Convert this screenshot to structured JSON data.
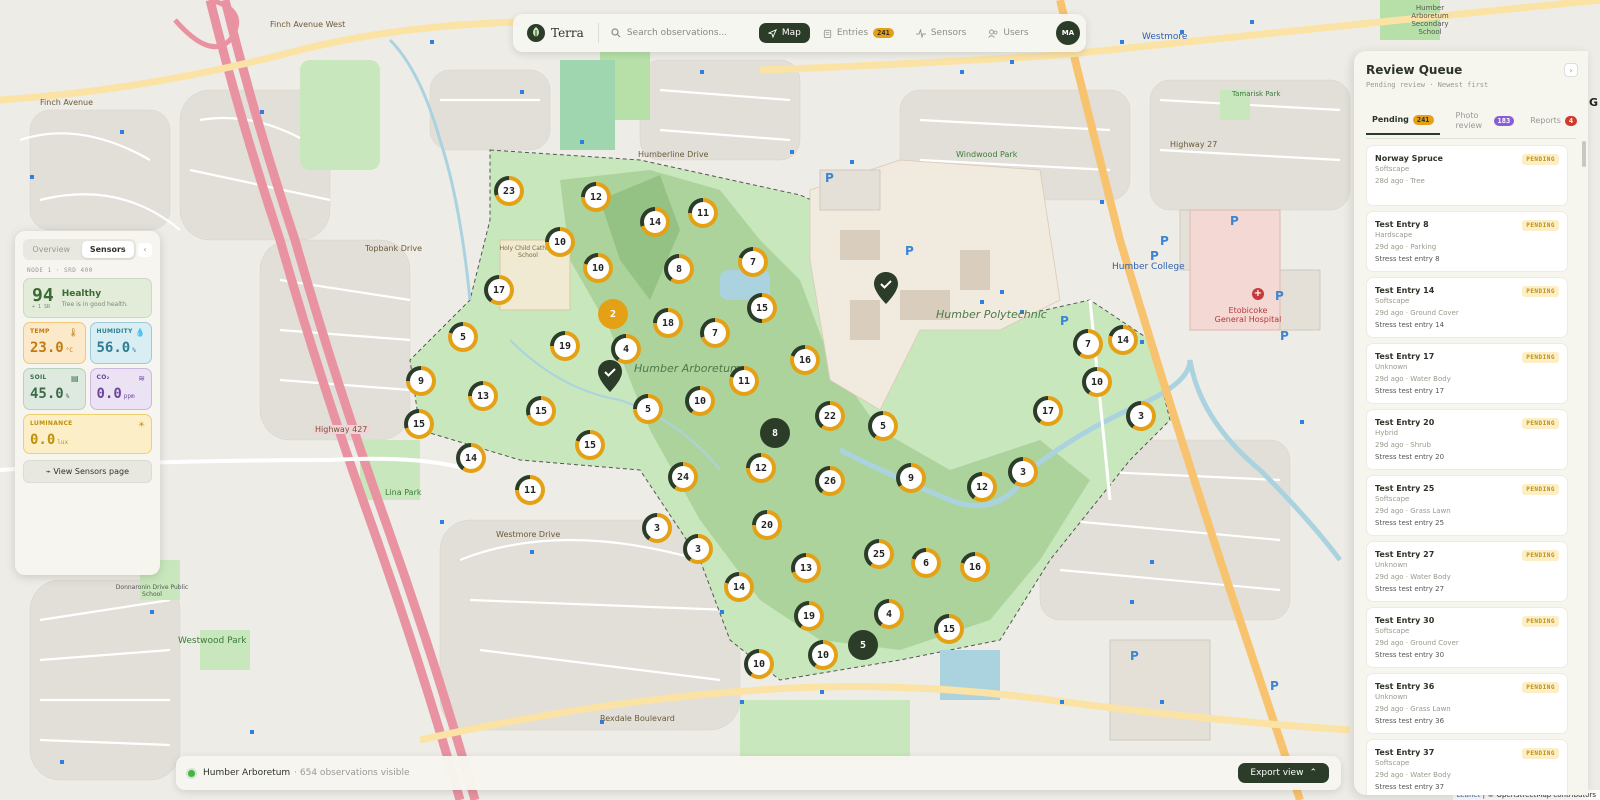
{
  "app": {
    "name": "Terra"
  },
  "nav": {
    "search_placeholder": "Search observations...",
    "tabs": [
      {
        "label": "Map",
        "icon": "navigation-arrow-icon",
        "active": true
      },
      {
        "label": "Entries",
        "icon": "clipboard-icon",
        "badge": "241"
      },
      {
        "label": "Sensors",
        "icon": "activity-pulse-icon"
      },
      {
        "label": "Users",
        "icon": "users-icon"
      }
    ],
    "user_initials": "MA"
  },
  "left_panel": {
    "tabs": [
      "Overview",
      "Sensors"
    ],
    "active_tab": "Sensors",
    "node_id": "NODE 1",
    "node_code": "SRD 400",
    "health": {
      "score": "94",
      "score_sub": "+ 1 SR",
      "title": "Healthy",
      "subtitle": "Tree is in good health."
    },
    "metrics": {
      "temp": {
        "label": "TEMP",
        "value": "23.0",
        "unit": "°C",
        "icon": "thermometer-icon"
      },
      "humidity": {
        "label": "HUMIDITY",
        "value": "56.0",
        "unit": "%",
        "icon": "droplet-icon"
      },
      "soil": {
        "label": "SOIL",
        "value": "45.0",
        "unit": "%",
        "icon": "soil-icon"
      },
      "co2": {
        "label": "CO₂",
        "value": "0.0",
        "unit": "ppm",
        "icon": "co2-icon"
      },
      "luminance": {
        "label": "LUMINANCE",
        "value": "0.0",
        "unit": "lux",
        "icon": "sun-icon"
      }
    },
    "button_label": "View Sensors page"
  },
  "queue": {
    "title": "Review Queue",
    "subtitle": "Pending review · Newest first",
    "tabs": [
      {
        "label": "Pending",
        "badge": "241",
        "active": true
      },
      {
        "label": "Photo review",
        "badge": "183"
      },
      {
        "label": "Reports",
        "badge": "4"
      }
    ],
    "items": [
      {
        "title": "Norway Spruce",
        "category": "Softscape",
        "meta": "28d ago · Tree",
        "note": "",
        "status": "PENDING"
      },
      {
        "title": "Test Entry 8",
        "category": "Hardscape",
        "meta": "29d ago · Parking",
        "note": "Stress test entry 8",
        "status": "PENDING"
      },
      {
        "title": "Test Entry 14",
        "category": "Softscape",
        "meta": "29d ago · Ground Cover",
        "note": "Stress test entry 14",
        "status": "PENDING"
      },
      {
        "title": "Test Entry 17",
        "category": "Unknown",
        "meta": "29d ago · Water Body",
        "note": "Stress test entry 17",
        "status": "PENDING"
      },
      {
        "title": "Test Entry 20",
        "category": "Hybrid",
        "meta": "29d ago · Shrub",
        "note": "Stress test entry 20",
        "status": "PENDING"
      },
      {
        "title": "Test Entry 25",
        "category": "Softscape",
        "meta": "29d ago · Grass Lawn",
        "note": "Stress test entry 25",
        "status": "PENDING"
      },
      {
        "title": "Test Entry 27",
        "category": "Unknown",
        "meta": "29d ago · Water Body",
        "note": "Stress test entry 27",
        "status": "PENDING"
      },
      {
        "title": "Test Entry 30",
        "category": "Softscape",
        "meta": "29d ago · Ground Cover",
        "note": "Stress test entry 30",
        "status": "PENDING"
      },
      {
        "title": "Test Entry 36",
        "category": "Unknown",
        "meta": "29d ago · Grass Lawn",
        "note": "Stress test entry 36",
        "status": "PENDING"
      },
      {
        "title": "Test Entry 37",
        "category": "Softscape",
        "meta": "29d ago · Water Body",
        "note": "Stress test entry 37",
        "status": "PENDING"
      }
    ]
  },
  "bottom_bar": {
    "location": "Humber Arboretum",
    "count_text": "· 654 observations visible",
    "export_label": "Export view"
  },
  "map": {
    "attribution_leaflet": "Leaflet",
    "attribution_osm": "| © OpenStreetMap contributors",
    "place_labels": [
      "Humber Arboretum",
      "Humber Polytechnic",
      "Humber College",
      "Etobicoke General Hospital",
      "Westmore",
      "Finch Avenue West",
      "Finch Avenue",
      "Highway 427",
      "Highway 27",
      "Rexdale Boulevard",
      "Westwood Park",
      "Donnaronin Drive Public School",
      "Holy Child Catholic School",
      "Lina Park",
      "Windwood Park",
      "Humberline Drive",
      "Westmore Drive",
      "Topbank Drive",
      "Humber Arboretum Secondary School",
      "Tamarisk Park"
    ],
    "clusters": [
      {
        "value": 23,
        "ratio": 0.7
      },
      {
        "value": 12,
        "ratio": 0.75
      },
      {
        "value": 14,
        "ratio": 0.7
      },
      {
        "value": 11,
        "ratio": 0.75
      },
      {
        "value": 10,
        "ratio": 0.75
      },
      {
        "value": 10,
        "ratio": 0.8
      },
      {
        "value": 8,
        "ratio": 0.6
      },
      {
        "value": 7,
        "ratio": 0.8
      },
      {
        "value": 17,
        "ratio": 0.6
      },
      {
        "value": 15,
        "ratio": 0.5
      },
      {
        "value": 2,
        "ratio": 1
      },
      {
        "value": 18,
        "ratio": 0.75
      },
      {
        "value": 7,
        "ratio": 0.7
      },
      {
        "value": 5,
        "ratio": 0.8
      },
      {
        "value": 19,
        "ratio": 0.75
      },
      {
        "value": 4,
        "ratio": 0.6
      },
      {
        "value": 16,
        "ratio": 0.8
      },
      {
        "value": 9,
        "ratio": 0.75
      },
      {
        "value": 13,
        "ratio": 0.75
      },
      {
        "value": 15,
        "ratio": 0.7
      },
      {
        "value": 5,
        "ratio": 0.75
      },
      {
        "value": 10,
        "ratio": 0.6
      },
      {
        "value": 11,
        "ratio": 0.8
      },
      {
        "value": 22,
        "ratio": 0.6
      },
      {
        "value": 5,
        "ratio": 0.6
      },
      {
        "value": 15,
        "ratio": 0.7
      },
      {
        "value": 14,
        "ratio": 0.6
      },
      {
        "value": 15,
        "ratio": 0.8
      },
      {
        "value": 8,
        "ratio": 1
      },
      {
        "value": 24,
        "ratio": 0.6
      },
      {
        "value": 12,
        "ratio": 0.75
      },
      {
        "value": 26,
        "ratio": 0.6
      },
      {
        "value": 9,
        "ratio": 0.65
      },
      {
        "value": 12,
        "ratio": 0.6
      },
      {
        "value": 3,
        "ratio": 0.6
      },
      {
        "value": 11,
        "ratio": 0.75
      },
      {
        "value": 3,
        "ratio": 0.6
      },
      {
        "value": 20,
        "ratio": 0.75
      },
      {
        "value": 3,
        "ratio": 0.6
      },
      {
        "value": 13,
        "ratio": 0.7
      },
      {
        "value": 25,
        "ratio": 0.6
      },
      {
        "value": 6,
        "ratio": 0.8
      },
      {
        "value": 16,
        "ratio": 0.8
      },
      {
        "value": 14,
        "ratio": 0.8
      },
      {
        "value": 19,
        "ratio": 0.6
      },
      {
        "value": 4,
        "ratio": 0.6
      },
      {
        "value": 15,
        "ratio": 0.7
      },
      {
        "value": 10,
        "ratio": 0.6
      },
      {
        "value": 5,
        "ratio": 1
      },
      {
        "value": 10,
        "ratio": 0.6
      },
      {
        "value": 7,
        "ratio": 0.6
      },
      {
        "value": 14,
        "ratio": 0.8
      },
      {
        "value": 10,
        "ratio": 0.6
      },
      {
        "value": 17,
        "ratio": 0.6
      },
      {
        "value": 3,
        "ratio": 0.6
      }
    ]
  },
  "colors": {
    "accent_dark": "#2b3c28",
    "accent_gold": "#e4a116",
    "park_green": "#c9e7bd",
    "forest_green": "#a8cf98",
    "water": "#aad3df",
    "highway": "#e892a2",
    "trunk": "#f8c36e"
  }
}
